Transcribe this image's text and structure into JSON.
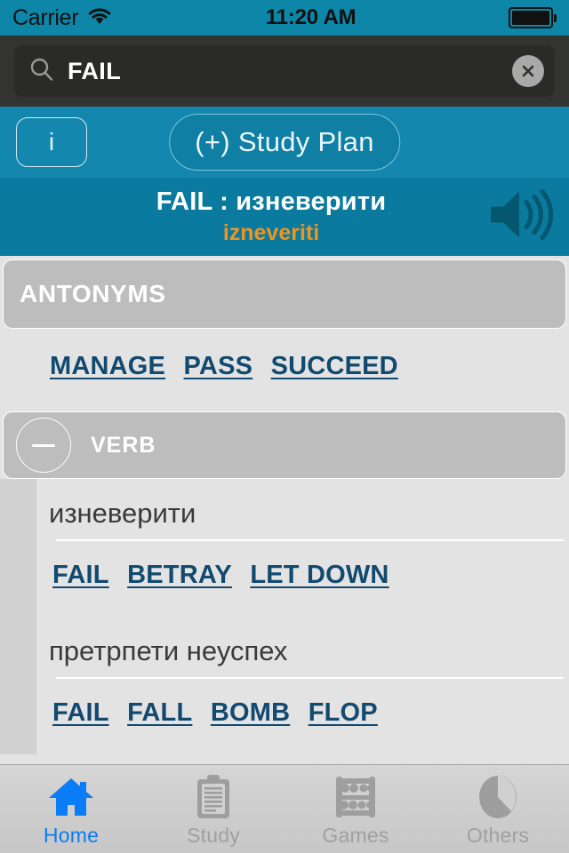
{
  "statusbar": {
    "carrier": "Carrier",
    "wifi_icon": "wifi-icon",
    "time": "11:20 AM",
    "battery_icon": "battery-full-icon"
  },
  "search": {
    "icon": "search-icon",
    "value": "FAIL",
    "placeholder": "Search",
    "clear_icon": "clear-circle-icon"
  },
  "toolbar": {
    "info_label": "i",
    "study_plan_label": "(+) Study Plan"
  },
  "word_header": {
    "headword": "FAIL : изневерити",
    "transliteration": "izneveriti",
    "speaker_icon": "speaker-icon"
  },
  "sections": [
    {
      "title": "ANTONYMS",
      "collapsible": false,
      "links": [
        "MANAGE",
        "PASS",
        "SUCCEED"
      ]
    },
    {
      "title": "VERB",
      "collapsible": true,
      "collapse_icon": "minus-circle-icon",
      "entries": [
        {
          "term": "изневерити",
          "links": [
            "FAIL",
            "BETRAY",
            "LET DOWN"
          ]
        },
        {
          "term": "претрпети неуспех",
          "links": [
            "FAIL",
            "FALL",
            "BOMB",
            "FLOP"
          ]
        }
      ]
    }
  ],
  "tabbar": {
    "items": [
      {
        "label": "Home",
        "icon": "home-icon",
        "active": true
      },
      {
        "label": "Study",
        "icon": "clipboard-icon",
        "active": false
      },
      {
        "label": "Games",
        "icon": "abacus-icon",
        "active": false
      },
      {
        "label": "Others",
        "icon": "pie-icon",
        "active": false
      }
    ]
  },
  "colors": {
    "status_teal": "#0e86a8",
    "toolbar_teal": "#1387ae",
    "header_teal": "#0a7b9e",
    "accent_orange": "#f0941e",
    "link_navy": "#12496f",
    "section_gray": "#bdbdbd",
    "content_gray": "#e3e3e3",
    "tab_active_blue": "#0a7cf5",
    "search_dark": "#333330"
  }
}
